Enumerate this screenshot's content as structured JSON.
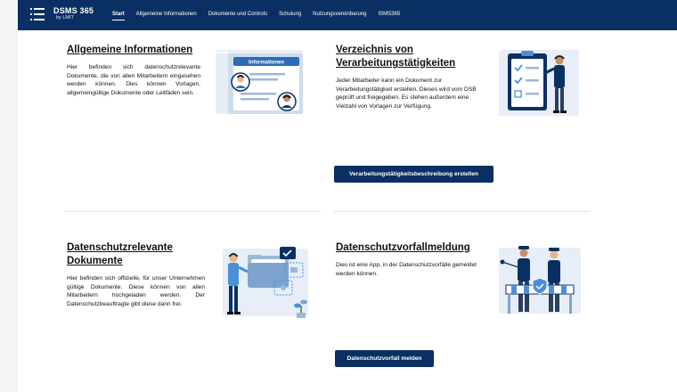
{
  "header": {
    "brand": "DSMS 365",
    "brand_sub": "by LMIT",
    "nav": [
      "Start",
      "Allgemeine Informationen",
      "Dokumente und Controls",
      "Schulung",
      "Nutzungsvereinbarung",
      "ISMS365"
    ]
  },
  "sections": {
    "general": {
      "title": "Allgemeine Informationen",
      "text": "Hier befinden sich datenschutzrelevante Dokumente, die von allen Mitarbeitern eingesehen werden können. Dies können Vorlagen, allgemeingültige Dokumente oder Leitfäden sein.",
      "illustration_label": "Informationen"
    },
    "register": {
      "title_line1": "Verzeichnis von",
      "title_line2": "Verarbeitungstätigkeiten",
      "text": "Jeder Mitarbeiter kann ein Dokument zur Verarbeitungstätigkeit erstellen. Dieses wird vom DSB geprüft und freigegeben. Es stehen außerdem eine Vielzahl von Vorlagen zur Verfügung.",
      "button": "Verarbeitungstätigkeitsbeschreibung erstellen"
    },
    "documents": {
      "title_line1": "Datenschutzrelevante",
      "title_line2": "Dokumente",
      "text": "Hier befinden sich offizielle, für unser Unternehmen gültige Dokumente. Diese können von allen Mitarbeitern hochgeladen werden. Der Datenschutzbeauftragte gibt diese dann frei."
    },
    "incident": {
      "title": "Datenschutzvorfallmeldung",
      "text": "Dies ist eine App, in der Datenschutzvorfälle gemeldet werden können.",
      "button": "Datenschutzvorfall melden"
    }
  },
  "colors": {
    "navy": "#0a3063",
    "accent_blue": "#4a90d9",
    "illustration_bg": "#e7eef7"
  }
}
